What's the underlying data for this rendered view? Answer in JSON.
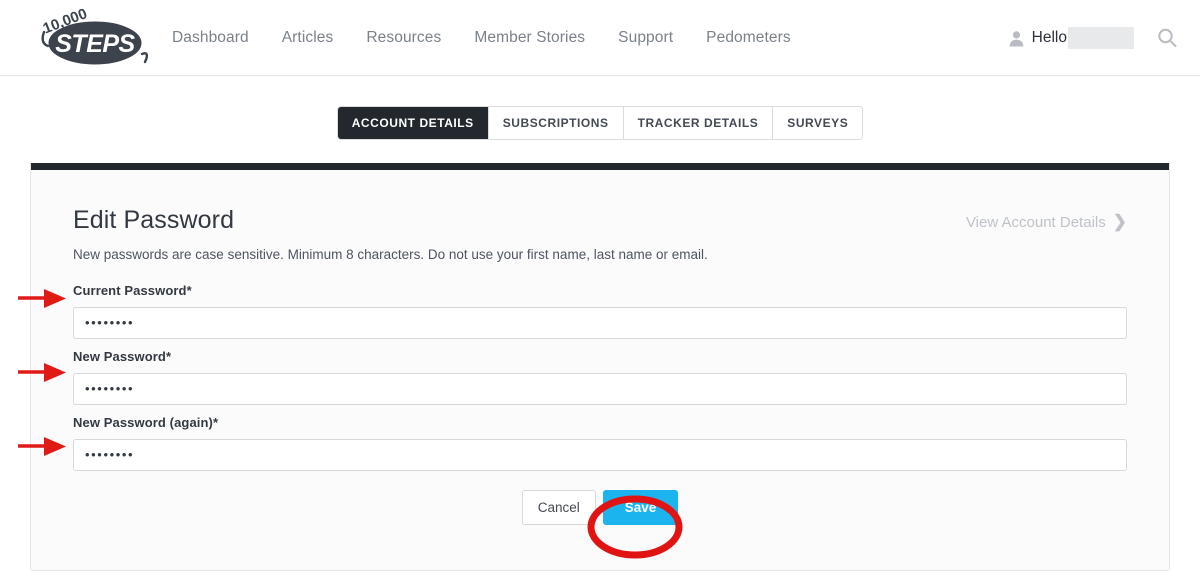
{
  "header": {
    "logo_top_text": "10,000",
    "logo_main_text": "STEPS",
    "logo_name": "10000-steps-logo",
    "nav": [
      {
        "label": "Dashboard"
      },
      {
        "label": "Articles"
      },
      {
        "label": "Resources"
      },
      {
        "label": "Member Stories"
      },
      {
        "label": "Support"
      },
      {
        "label": "Pedometers"
      }
    ],
    "greeting": "Hello",
    "username_redacted": "",
    "user_icon": "user-icon",
    "search_icon": "search-icon"
  },
  "tabs": [
    {
      "label": "ACCOUNT DETAILS",
      "active": true
    },
    {
      "label": "SUBSCRIPTIONS",
      "active": false
    },
    {
      "label": "TRACKER DETAILS",
      "active": false
    },
    {
      "label": "SURVEYS",
      "active": false
    }
  ],
  "panel": {
    "title": "Edit Password",
    "subtitle": "New passwords are case sensitive. Minimum 8 characters. Do not use your first name, last name or email.",
    "view_account_link": "View Account Details",
    "chevron": "❯"
  },
  "form": {
    "fields": [
      {
        "label": "Current Password",
        "required_mark": "*",
        "value": "••••••••",
        "placeholder": ""
      },
      {
        "label": "New Password",
        "required_mark": "*",
        "value": "••••••••",
        "placeholder": ""
      },
      {
        "label": "New Password (again)",
        "required_mark": "*",
        "value": "••••••••",
        "placeholder": ""
      }
    ],
    "cancel_label": "Cancel",
    "save_label": "Save"
  },
  "annotations": {
    "arrow_color": "#e01b16",
    "ellipse_color": "#e11414",
    "arrow_count": 3,
    "ellipse_target": "save-button"
  },
  "colors": {
    "accent_blue": "#1cb4ee",
    "dark_bar": "#23272e",
    "nav_text": "#7b828c",
    "card_bg": "#fbfbfb",
    "annotation_red": "#e01b16"
  }
}
